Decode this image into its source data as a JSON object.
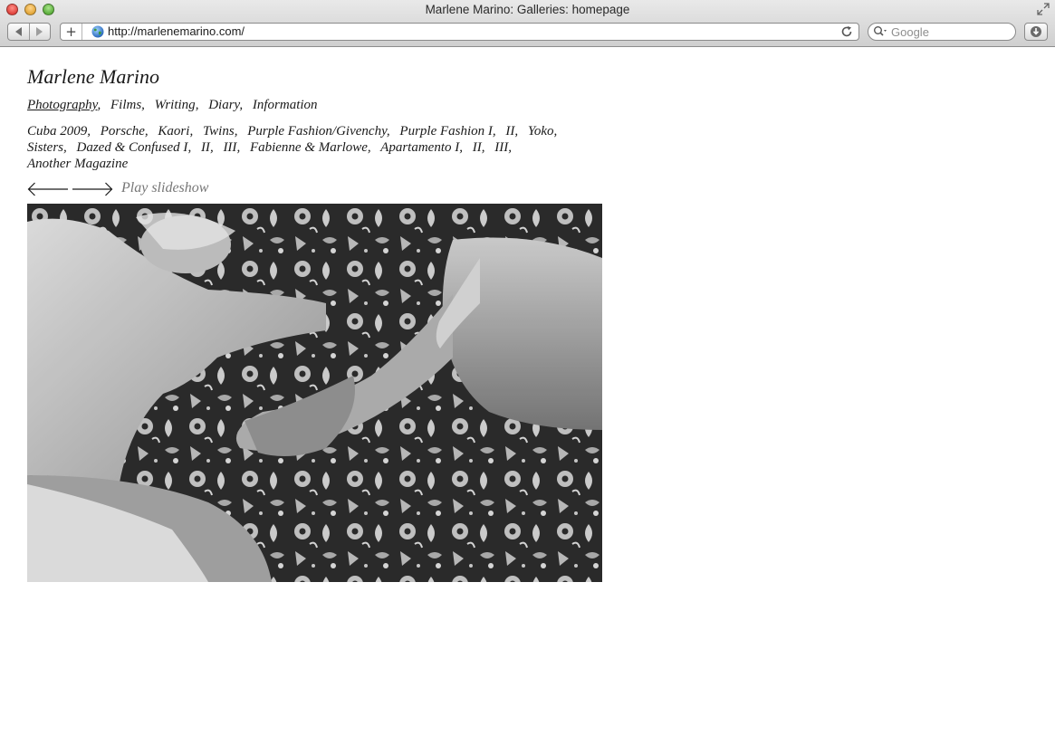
{
  "browser": {
    "window_title": "Marlene Marino: Galleries: homepage",
    "url": "http://marlenemarino.com/",
    "search_placeholder": "Google",
    "new_tab_label": "+"
  },
  "site": {
    "title": "Marlene Marino",
    "nav": [
      {
        "label": "Photography",
        "active": true
      },
      {
        "label": "Films",
        "active": false
      },
      {
        "label": "Writing",
        "active": false
      },
      {
        "label": "Diary",
        "active": false
      },
      {
        "label": "Information",
        "active": false
      }
    ],
    "galleries": [
      "Cuba 2009",
      "Porsche",
      "Kaori",
      "Twins",
      "Purple Fashion/Givenchy",
      "Purple Fashion I",
      "II",
      "Yoko",
      "Sisters",
      "Dazed & Confused I",
      "II",
      "III",
      "Fabienne & Marlowe",
      "Apartamento I",
      "II",
      "III",
      "Another Magazine"
    ],
    "separator": ",",
    "play_slideshow": "Play slideshow"
  },
  "colors": {
    "text": "#1a1a1a",
    "muted": "#777777",
    "background": "#ffffff"
  }
}
